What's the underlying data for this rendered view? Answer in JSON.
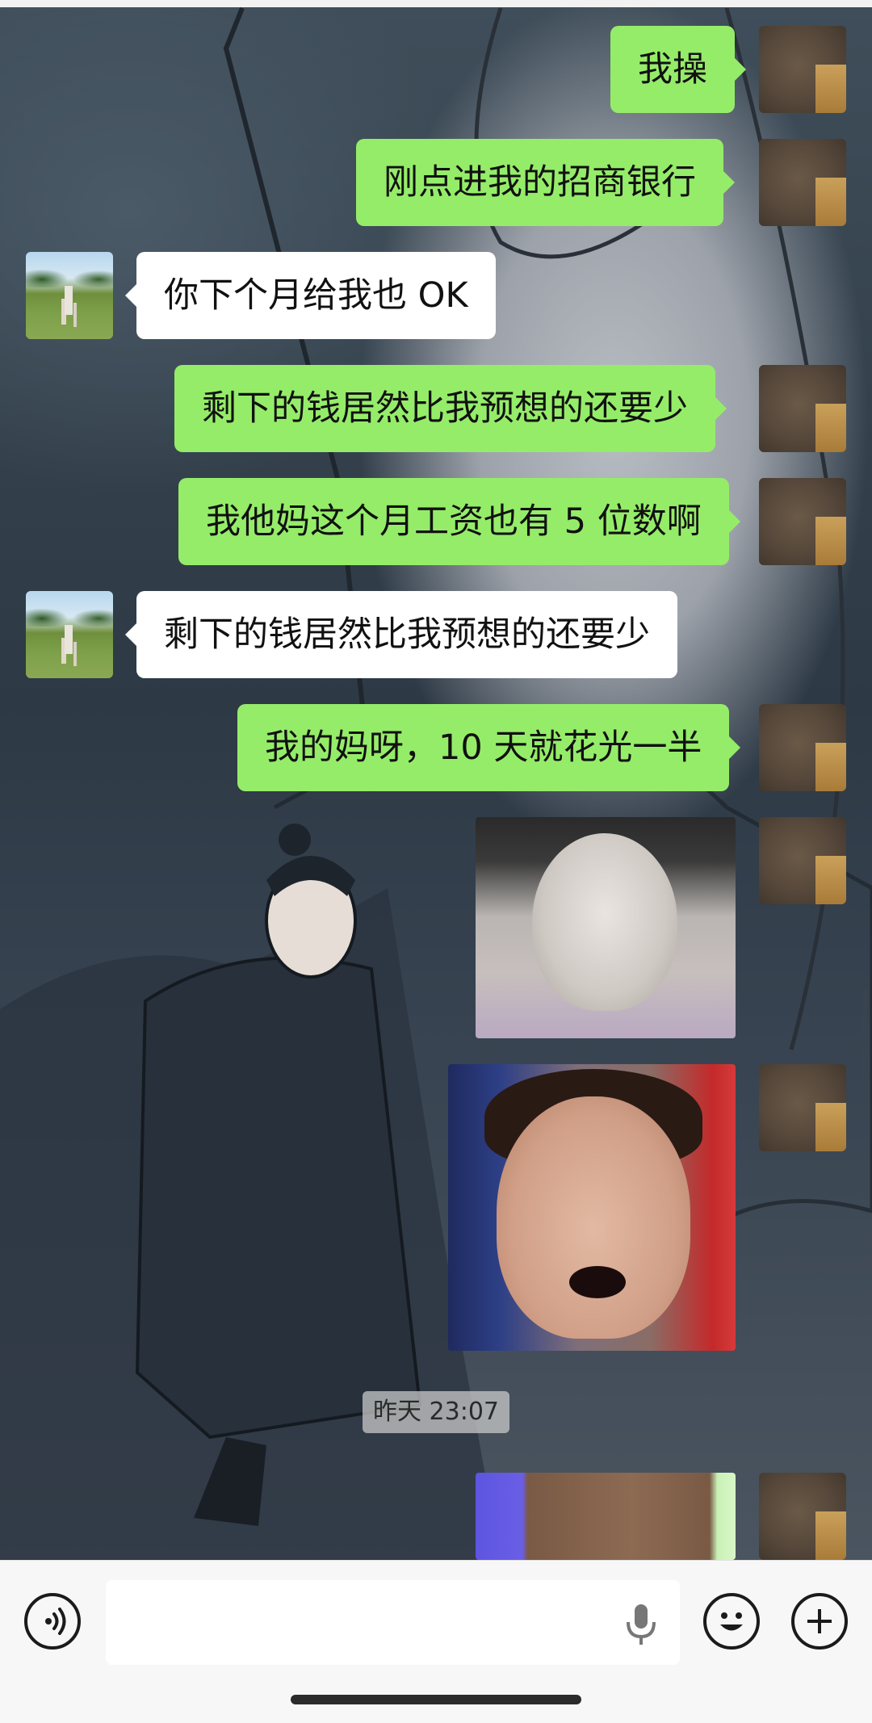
{
  "messages": [
    {
      "side": "sent",
      "type": "text",
      "text": "我操"
    },
    {
      "side": "sent",
      "type": "text",
      "text": "刚点进我的招商银行"
    },
    {
      "side": "received",
      "type": "text",
      "text": "你下个月给我也 OK"
    },
    {
      "side": "sent",
      "type": "text",
      "text": "剩下的钱居然比我预想的还要少"
    },
    {
      "side": "sent",
      "type": "text",
      "text": "我他妈这个月工资也有 5 位数啊"
    },
    {
      "side": "received",
      "type": "text",
      "text": "剩下的钱居然比我预想的还要少"
    },
    {
      "side": "sent",
      "type": "text",
      "text": "我的妈呀，10 天就花光一半"
    },
    {
      "side": "sent",
      "type": "sticker",
      "sticker": "startled-face"
    },
    {
      "side": "sent",
      "type": "sticker",
      "sticker": "shocked-man-face"
    },
    {
      "side": "sent",
      "type": "sticker",
      "sticker": "partial-sticker"
    }
  ],
  "timestamp": "昨天 23:07",
  "input": {
    "value": "",
    "voice_icon": "voice-icon",
    "mic_icon": "microphone-icon",
    "emoji_icon": "emoji-icon",
    "plus_icon": "plus-icon"
  },
  "colors": {
    "sent_bubble": "#95ec69",
    "received_bubble": "#ffffff",
    "input_bar": "#f7f7f7"
  }
}
